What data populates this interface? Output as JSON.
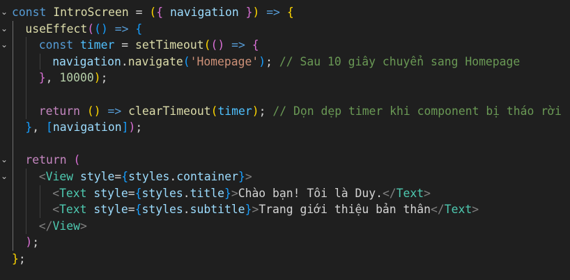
{
  "editor": {
    "lines": [
      {
        "fold": "⌄",
        "indent": 0,
        "tokens": [
          {
            "t": "const",
            "c": "kw"
          },
          {
            "t": " ",
            "c": "pl"
          },
          {
            "t": "IntroScreen",
            "c": "fn"
          },
          {
            "t": " = ",
            "c": "pl"
          },
          {
            "t": "(",
            "c": "b1"
          },
          {
            "t": "{",
            "c": "b2"
          },
          {
            "t": " navigation ",
            "c": "var"
          },
          {
            "t": "}",
            "c": "b2"
          },
          {
            "t": ")",
            "c": "b1"
          },
          {
            "t": " ",
            "c": "pl"
          },
          {
            "t": "=>",
            "c": "kw"
          },
          {
            "t": " ",
            "c": "pl"
          },
          {
            "t": "{",
            "c": "b1"
          }
        ]
      },
      {
        "fold": "⌄",
        "indent": 1,
        "tokens": [
          {
            "t": "useEffect",
            "c": "fn"
          },
          {
            "t": "(",
            "c": "b2"
          },
          {
            "t": "(",
            "c": "b3"
          },
          {
            "t": ")",
            "c": "b3"
          },
          {
            "t": " ",
            "c": "pl"
          },
          {
            "t": "=>",
            "c": "kw"
          },
          {
            "t": " ",
            "c": "pl"
          },
          {
            "t": "{",
            "c": "b3"
          }
        ]
      },
      {
        "fold": "⌄",
        "indent": 2,
        "tokens": [
          {
            "t": "const",
            "c": "kw"
          },
          {
            "t": " ",
            "c": "pl"
          },
          {
            "t": "timer",
            "c": "const"
          },
          {
            "t": " = ",
            "c": "pl"
          },
          {
            "t": "setTimeout",
            "c": "fn"
          },
          {
            "t": "(",
            "c": "b1"
          },
          {
            "t": "(",
            "c": "b2"
          },
          {
            "t": ")",
            "c": "b2"
          },
          {
            "t": " ",
            "c": "pl"
          },
          {
            "t": "=>",
            "c": "kw"
          },
          {
            "t": " ",
            "c": "pl"
          },
          {
            "t": "{",
            "c": "b2"
          }
        ]
      },
      {
        "fold": "",
        "indent": 3,
        "tokens": [
          {
            "t": "navigation",
            "c": "var"
          },
          {
            "t": ".",
            "c": "pl"
          },
          {
            "t": "navigate",
            "c": "fn"
          },
          {
            "t": "(",
            "c": "b3"
          },
          {
            "t": "'Homepage'",
            "c": "str"
          },
          {
            "t": ")",
            "c": "b3"
          },
          {
            "t": "; ",
            "c": "pl"
          },
          {
            "t": "// Sau 10 giây chuyển sang Homepage",
            "c": "cm"
          }
        ]
      },
      {
        "fold": "",
        "indent": 2,
        "tokens": [
          {
            "t": "}",
            "c": "b2"
          },
          {
            "t": ", ",
            "c": "pl"
          },
          {
            "t": "10000",
            "c": "num"
          },
          {
            "t": ")",
            "c": "b1"
          },
          {
            "t": ";",
            "c": "pl"
          }
        ]
      },
      {
        "fold": "",
        "indent": 0,
        "tokens": []
      },
      {
        "fold": "",
        "indent": 2,
        "tokens": [
          {
            "t": "return",
            "c": "ctl"
          },
          {
            "t": " ",
            "c": "pl"
          },
          {
            "t": "(",
            "c": "b1"
          },
          {
            "t": ")",
            "c": "b1"
          },
          {
            "t": " ",
            "c": "pl"
          },
          {
            "t": "=>",
            "c": "kw"
          },
          {
            "t": " ",
            "c": "pl"
          },
          {
            "t": "clearTimeout",
            "c": "fn"
          },
          {
            "t": "(",
            "c": "b1"
          },
          {
            "t": "timer",
            "c": "const"
          },
          {
            "t": ")",
            "c": "b1"
          },
          {
            "t": "; ",
            "c": "pl"
          },
          {
            "t": "// Dọn dẹp timer khi component bị tháo rời",
            "c": "cm"
          }
        ]
      },
      {
        "fold": "",
        "indent": 1,
        "tokens": [
          {
            "t": "}",
            "c": "b3"
          },
          {
            "t": ", ",
            "c": "pl"
          },
          {
            "t": "[",
            "c": "b3"
          },
          {
            "t": "navigation",
            "c": "var"
          },
          {
            "t": "]",
            "c": "b3"
          },
          {
            "t": ")",
            "c": "b2"
          },
          {
            "t": ";",
            "c": "pl"
          }
        ]
      },
      {
        "fold": "",
        "indent": 0,
        "tokens": []
      },
      {
        "fold": "⌄",
        "indent": 1,
        "tokens": [
          {
            "t": "return",
            "c": "ctl"
          },
          {
            "t": " ",
            "c": "pl"
          },
          {
            "t": "(",
            "c": "b2"
          }
        ]
      },
      {
        "fold": "⌄",
        "indent": 2,
        "tokens": [
          {
            "t": "<",
            "c": "tb"
          },
          {
            "t": "View",
            "c": "tag"
          },
          {
            "t": " ",
            "c": "pl"
          },
          {
            "t": "style",
            "c": "at"
          },
          {
            "t": "=",
            "c": "pl"
          },
          {
            "t": "{",
            "c": "b3"
          },
          {
            "t": "styles",
            "c": "var"
          },
          {
            "t": ".",
            "c": "pl"
          },
          {
            "t": "container",
            "c": "var"
          },
          {
            "t": "}",
            "c": "b3"
          },
          {
            "t": ">",
            "c": "tb"
          }
        ]
      },
      {
        "fold": "",
        "indent": 3,
        "tokens": [
          {
            "t": "<",
            "c": "tb"
          },
          {
            "t": "Text",
            "c": "tag"
          },
          {
            "t": " ",
            "c": "pl"
          },
          {
            "t": "style",
            "c": "at"
          },
          {
            "t": "=",
            "c": "pl"
          },
          {
            "t": "{",
            "c": "b3"
          },
          {
            "t": "styles",
            "c": "var"
          },
          {
            "t": ".",
            "c": "pl"
          },
          {
            "t": "title",
            "c": "var"
          },
          {
            "t": "}",
            "c": "b3"
          },
          {
            "t": ">",
            "c": "tb"
          },
          {
            "t": "Chào bạn! Tôi là Duy.",
            "c": "pl"
          },
          {
            "t": "</",
            "c": "tb"
          },
          {
            "t": "Text",
            "c": "tag"
          },
          {
            "t": ">",
            "c": "tb"
          }
        ]
      },
      {
        "fold": "",
        "indent": 3,
        "tokens": [
          {
            "t": "<",
            "c": "tb"
          },
          {
            "t": "Text",
            "c": "tag"
          },
          {
            "t": " ",
            "c": "pl"
          },
          {
            "t": "style",
            "c": "at"
          },
          {
            "t": "=",
            "c": "pl"
          },
          {
            "t": "{",
            "c": "b3"
          },
          {
            "t": "styles",
            "c": "var"
          },
          {
            "t": ".",
            "c": "pl"
          },
          {
            "t": "subtitle",
            "c": "var"
          },
          {
            "t": "}",
            "c": "b3"
          },
          {
            "t": ">",
            "c": "tb"
          },
          {
            "t": "Trang giới thiệu bản thân",
            "c": "pl"
          },
          {
            "t": "</",
            "c": "tb"
          },
          {
            "t": "Text",
            "c": "tag"
          },
          {
            "t": ">",
            "c": "tb"
          }
        ]
      },
      {
        "fold": "",
        "indent": 2,
        "tokens": [
          {
            "t": "</",
            "c": "tb"
          },
          {
            "t": "View",
            "c": "tag"
          },
          {
            "t": ">",
            "c": "tb"
          }
        ]
      },
      {
        "fold": "",
        "indent": 1,
        "tokens": [
          {
            "t": ")",
            "c": "b2"
          },
          {
            "t": ";",
            "c": "pl"
          }
        ]
      },
      {
        "fold": "",
        "indent": 0,
        "tokens": [
          {
            "t": "}",
            "c": "b1"
          },
          {
            "t": ";",
            "c": "pl"
          }
        ]
      }
    ]
  }
}
